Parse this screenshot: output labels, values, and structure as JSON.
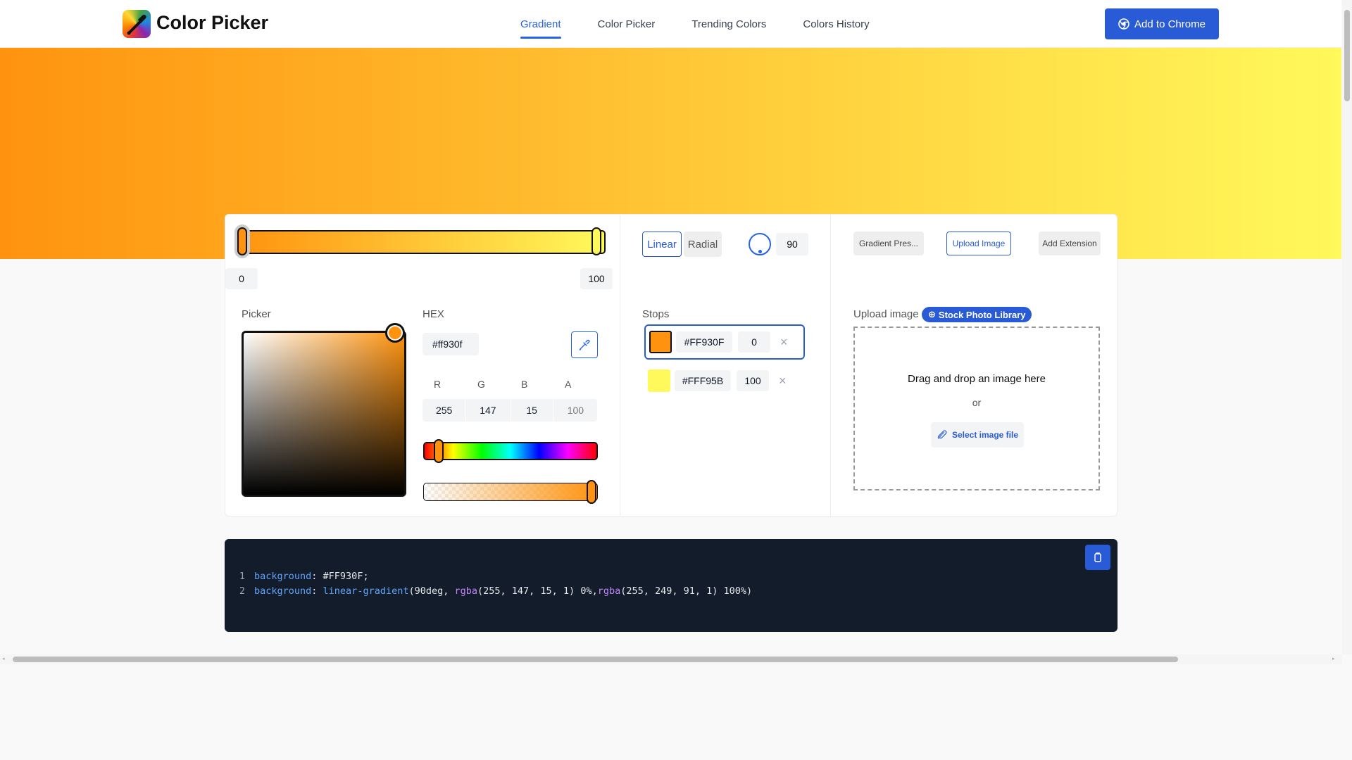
{
  "header": {
    "brand": "Color Picker",
    "nav": [
      "Gradient",
      "Color Picker",
      "Trending Colors",
      "Colors History"
    ],
    "cta": "Add to Chrome"
  },
  "gradient": {
    "start_label": "0",
    "end_label": "100",
    "start_color": "#FF930F",
    "end_color": "#FFF95B"
  },
  "picker": {
    "picker_label": "Picker",
    "hex_label": "HEX",
    "hex_value": "#ff930f",
    "rgba_labels": [
      "R",
      "G",
      "B",
      "A"
    ],
    "rgba_values": [
      "255",
      "147",
      "15",
      "100"
    ],
    "hue_level": 0.09,
    "alpha_level": 1.0
  },
  "type": {
    "linear": "Linear",
    "radial": "Radial",
    "angle": "90"
  },
  "stops": {
    "label": "Stops",
    "items": [
      {
        "hex": "#FF930F",
        "pos": "0",
        "color": "#ff930f"
      },
      {
        "hex": "#FFF95B",
        "pos": "100",
        "color": "#fff95b"
      }
    ]
  },
  "right": {
    "presets": "Gradient Pres...",
    "upload": "Upload Image",
    "extension": "Add Extension",
    "upload_label": "Upload image",
    "stock": "Stock Photo Library",
    "drag_text": "Drag and drop an image here",
    "or_text": "or",
    "select_btn": "Select image file"
  },
  "code": {
    "lines": [
      {
        "n": "1",
        "prop": "background",
        "sep": ": ",
        "value": "#FF930F;"
      },
      {
        "n": "2",
        "prop": "background",
        "sep": ": "
      }
    ],
    "line2_fn": "linear-gradient",
    "line2_a": "(90deg, ",
    "line2_rgba1": "rgba",
    "line2_b": "(255, 147, 15, 1) 0%,",
    "line2_rgba2": "rgba",
    "line2_c": "(255, 249, 91, 1) 100%)"
  },
  "colors": {
    "accent": "#2a5bd7",
    "code_bg": "#131c2a"
  }
}
